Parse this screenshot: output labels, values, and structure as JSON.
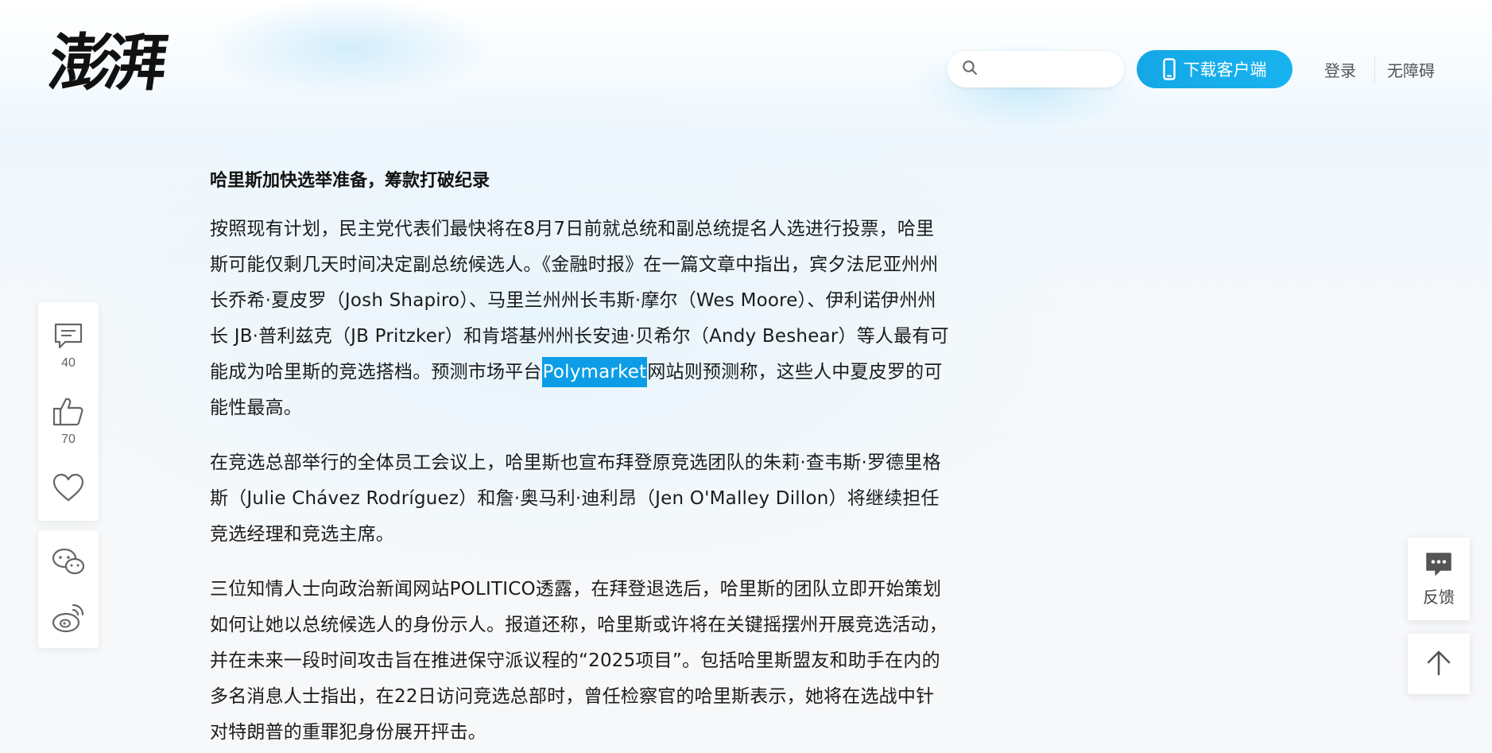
{
  "header": {
    "logo_text": "澎湃",
    "search_placeholder": "",
    "download_label": "下载客户端",
    "login_label": "登录",
    "accessibility_label": "无障碍"
  },
  "article": {
    "subtitle": "哈里斯加快选举准备，筹款打破纪录",
    "p1_before": "按照现有计划，民主党代表们最快将在8月7日前就总统和副总统提名人选进行投票，哈里斯可能仅剩几天时间决定副总统候选人。《金融时报》在一篇文章中指出，宾夕法尼亚州州长乔希·夏皮罗（Josh Shapiro）、马里兰州州长韦斯·摩尔（Wes Moore）、伊利诺伊州州长 JB·普利兹克（JB Pritzker）和肯塔基州州长安迪·贝希尔（Andy Beshear）等人最有可能成为哈里斯的竞选搭档。预测市场平台",
    "p1_highlight": "Polymarket",
    "p1_after": "网站则预测称，这些人中夏皮罗的可能性最高。",
    "p2": "在竞选总部举行的全体员工会议上，哈里斯也宣布拜登原竞选团队的朱莉·查韦斯·罗德里格斯（Julie Chávez Rodríguez）和詹·奥马利·迪利昂（Jen O'Malley Dillon）将继续担任竞选经理和竞选主席。",
    "p3": "三位知情人士向政治新闻网站POLITICO透露，在拜登退选后，哈里斯的团队立即开始策划如何让她以总统候选人的身份示人。报道还称，哈里斯或许将在关键摇摆州开展竞选活动，并在未来一段时间攻击旨在推进保守派议程的“2025项目”。包括哈里斯盟友和助手在内的多名消息人士指出，在22日访问竞选总部时，曾任检察官的哈里斯表示，她将在选战中针对特朗普的重罪犯身份展开抨击。"
  },
  "sidebar": {
    "comment_count": "40",
    "like_count": "70"
  },
  "float": {
    "feedback_label": "反馈"
  },
  "colors": {
    "accent": "#14a7e6",
    "highlight": "#0c9de6"
  }
}
